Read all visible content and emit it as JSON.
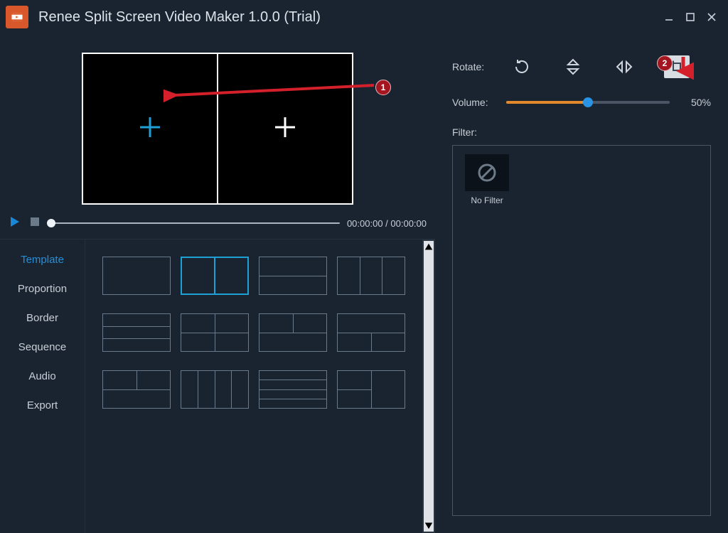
{
  "window": {
    "title": "Renee Split Screen Video Maker 1.0.0 (Trial)"
  },
  "playback": {
    "timecode": "00:00:00 / 00:00:00"
  },
  "tabs": {
    "items": [
      "Template",
      "Proportion",
      "Border",
      "Sequence",
      "Audio",
      "Export"
    ],
    "active_index": 0
  },
  "right_panel": {
    "rotate_label": "Rotate:",
    "volume_label": "Volume:",
    "volume_percent": 50,
    "volume_display": "50%",
    "filter_label": "Filter:",
    "filters": [
      {
        "name": "No Filter"
      }
    ]
  },
  "annotations": {
    "badge1": "1",
    "badge2": "2"
  },
  "colors": {
    "accent_blue": "#1e9fd6",
    "accent_orange": "#e28a2b",
    "badge_red": "#a3151f"
  }
}
